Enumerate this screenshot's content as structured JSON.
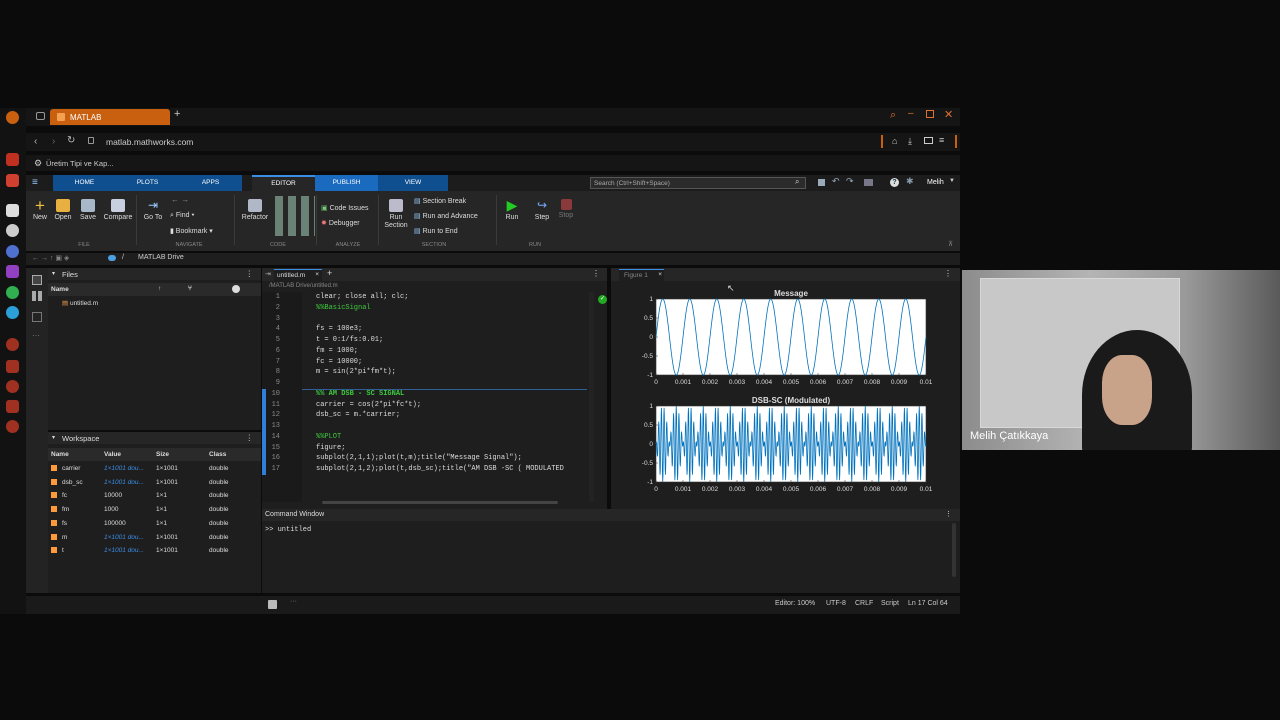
{
  "browser": {
    "tab_title": "MATLAB",
    "url": "matlab.mathworks.com",
    "bookmark": "Üretim Tipi ve Kap..."
  },
  "toolstrip": {
    "tabs": [
      "HOME",
      "PLOTS",
      "APPS",
      "EDITOR",
      "PUBLISH",
      "VIEW"
    ],
    "active_tab": "EDITOR",
    "search_placeholder": "Search (Ctrl+Shift+Space)",
    "user": "Melih"
  },
  "ribbon": {
    "file": {
      "new": "New",
      "open": "Open",
      "save": "Save",
      "compare": "Compare",
      "group": "FILE"
    },
    "navigate": {
      "goto": "Go To",
      "find": "Find",
      "bookmark": "Bookmark",
      "group": "NAVIGATE"
    },
    "code": {
      "refactor": "Refactor",
      "group": "CODE"
    },
    "analyze": {
      "code_issues": "Code Issues",
      "debugger": "Debugger",
      "group": "ANALYZE"
    },
    "section": {
      "run_section_1": "Run",
      "run_section_2": "Section",
      "section_break": "Section Break",
      "run_and_advance": "Run and Advance",
      "run_to_end": "Run to End",
      "group": "SECTION"
    },
    "run": {
      "run": "Run",
      "step": "Step",
      "stop": "Stop",
      "group": "RUN"
    }
  },
  "path": {
    "root": "/",
    "folder": "MATLAB Drive"
  },
  "files_panel": {
    "title": "Files",
    "col_name": "Name",
    "items": [
      "untitled.m"
    ]
  },
  "workspace": {
    "title": "Workspace",
    "headers": [
      "Name",
      "Value",
      "Size",
      "Class"
    ],
    "rows": [
      {
        "name": "carrier",
        "value": "1×1001 dou...",
        "size": "1×1001",
        "class": "double"
      },
      {
        "name": "dsb_sc",
        "value": "1×1001 dou...",
        "size": "1×1001",
        "class": "double"
      },
      {
        "name": "fc",
        "value": "10000",
        "size": "1×1",
        "class": "double"
      },
      {
        "name": "fm",
        "value": "1000",
        "size": "1×1",
        "class": "double"
      },
      {
        "name": "fs",
        "value": "100000",
        "size": "1×1",
        "class": "double"
      },
      {
        "name": "m",
        "value": "1×1001 dou...",
        "size": "1×1001",
        "class": "double"
      },
      {
        "name": "t",
        "value": "1×1001 dou...",
        "size": "1×1001",
        "class": "double"
      }
    ]
  },
  "editor": {
    "tab": "untitled.m",
    "path": "/MATLAB Drive/untitled.m",
    "lines": [
      {
        "n": "1",
        "text": "clear; close all; clc;"
      },
      {
        "n": "2",
        "text": "%%BasicSignal"
      },
      {
        "n": "3",
        "text": ""
      },
      {
        "n": "4",
        "text": "fs = 100e3;"
      },
      {
        "n": "5",
        "text": "t = 0:1/fs:0.01;"
      },
      {
        "n": "6",
        "text": "fm = 1000;"
      },
      {
        "n": "7",
        "text": "fc = 10000;"
      },
      {
        "n": "8",
        "text": "m = sin(2*pi*fm*t);"
      },
      {
        "n": "9",
        "text": ""
      },
      {
        "n": "10",
        "text": "%% AM DSB - SC SIGNAL"
      },
      {
        "n": "11",
        "text": "carrier = cos(2*pi*fc*t);"
      },
      {
        "n": "12",
        "text": "dsb_sc = m.*carrier;"
      },
      {
        "n": "13",
        "text": ""
      },
      {
        "n": "14",
        "text": "%%PLOT"
      },
      {
        "n": "15",
        "text": "figure;"
      },
      {
        "n": "16",
        "text": "subplot(2,1,1);plot(t,m);title(\"Message Signal\");"
      },
      {
        "n": "17",
        "text": "subplot(2,1,2);plot(t,dsb_sc);title(\"AM DSB -SC ( MODULATED"
      }
    ]
  },
  "figure": {
    "tab": "Figure 1",
    "chart_data": [
      {
        "type": "line",
        "title": "Message",
        "xlim": [
          0,
          0.01
        ],
        "ylim": [
          -1,
          1
        ],
        "xticks": [
          "0",
          "0.001",
          "0.002",
          "0.003",
          "0.004",
          "0.005",
          "0.006",
          "0.007",
          "0.008",
          "0.009",
          "0.01"
        ],
        "yticks": [
          "1",
          "0.5",
          "0",
          "-0.5",
          "-1"
        ],
        "fs": 100000,
        "fm": 1000,
        "color": "#0072bd"
      },
      {
        "type": "line",
        "title": "DSB-SC (Modulated)",
        "xlim": [
          0,
          0.01
        ],
        "ylim": [
          -1,
          1
        ],
        "xticks": [
          "0",
          "0.001",
          "0.002",
          "0.003",
          "0.004",
          "0.005",
          "0.006",
          "0.007",
          "0.008",
          "0.009",
          "0.01"
        ],
        "yticks": [
          "1",
          "0.5",
          "0",
          "-0.5",
          "-1"
        ],
        "fs": 100000,
        "fm": 1000,
        "fc": 10000,
        "color": "#0072bd"
      }
    ]
  },
  "command_window": {
    "title": "Command Window",
    "line": ">> untitled"
  },
  "status": {
    "zoom": "Editor: 100%",
    "encoding": "UTF-8",
    "eol": "CRLF",
    "type": "Script",
    "position": "Ln 17 Col 64"
  },
  "video": {
    "name": "Melih Çatıkkaya"
  }
}
